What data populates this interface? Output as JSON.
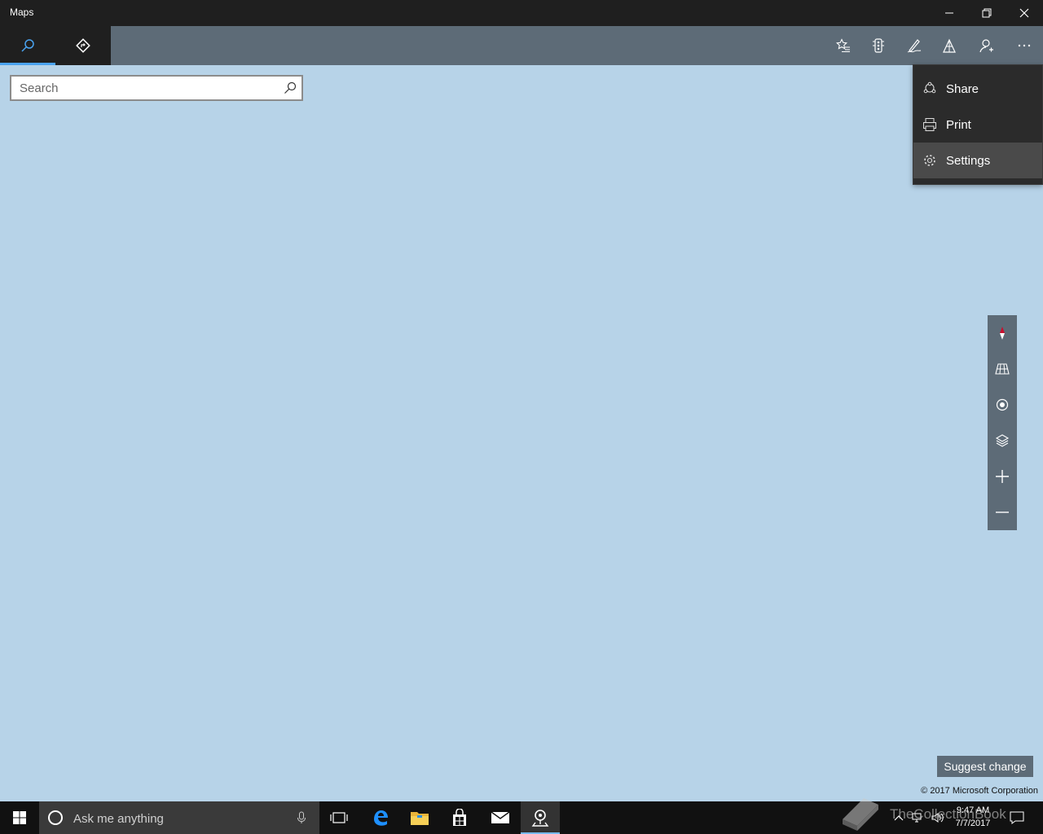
{
  "window": {
    "title": "Maps"
  },
  "tabs": [
    {
      "name": "search",
      "icon": "search-icon"
    },
    {
      "name": "directions",
      "icon": "directions-icon"
    }
  ],
  "toolbar_icons": [
    "favorites-icon",
    "traffic-icon",
    "ink-icon",
    "3d-cities-icon",
    "account-icon",
    "more-icon"
  ],
  "search": {
    "placeholder": "Search"
  },
  "menu": {
    "items": [
      {
        "label": "Share",
        "icon": "share-icon"
      },
      {
        "label": "Print",
        "icon": "print-icon"
      },
      {
        "label": "Settings",
        "icon": "settings-icon"
      }
    ]
  },
  "map_controls": [
    "compass-icon",
    "tilt-icon",
    "locate-icon",
    "layers-icon",
    "zoom-in-icon",
    "zoom-out-icon"
  ],
  "map": {
    "suggest_label": "Suggest change",
    "copyright": "© 2017 Microsoft Corporation"
  },
  "taskbar": {
    "cortana_placeholder": "Ask me anything",
    "time": "9:47 AM",
    "date": "7/7/2017"
  },
  "watermark": "TheCollectionBook",
  "colors": {
    "accent": "#4aa3f0",
    "map_bg": "#b7d3e8",
    "toolbar_bg": "#5d6b77",
    "menu_bg": "#2b2b2b"
  }
}
